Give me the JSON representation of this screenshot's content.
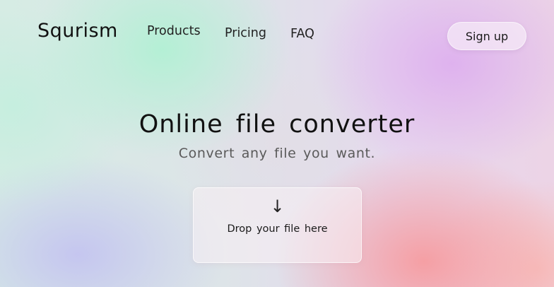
{
  "header": {
    "logo": "Squrism",
    "nav": [
      {
        "label": "Products"
      },
      {
        "label": "Pricing"
      },
      {
        "label": "FAQ"
      }
    ],
    "signup_label": "Sign up"
  },
  "hero": {
    "title": "Online file converter",
    "subtitle": "Convert any file you want."
  },
  "dropzone": {
    "icon": "down-arrow-icon",
    "arrow_glyph": "↓",
    "label": "Drop your file here"
  }
}
